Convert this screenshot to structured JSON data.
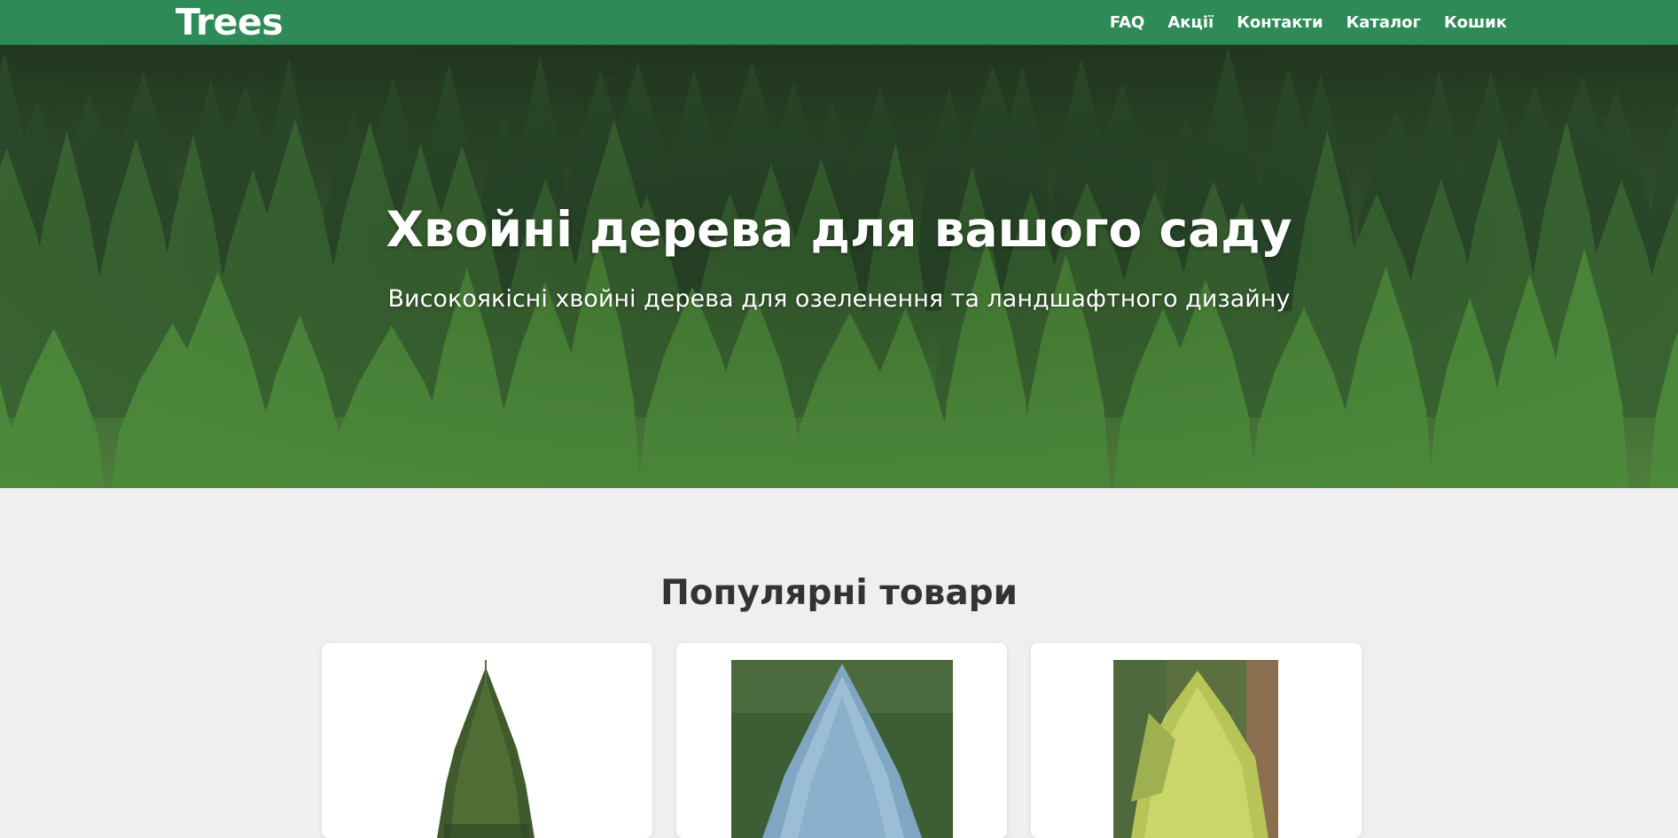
{
  "nav": {
    "logo": "Trees",
    "links": [
      "FAQ",
      "Акції",
      "Контакти",
      "Каталог",
      "Кошик"
    ]
  },
  "hero": {
    "title": "Хвойні дерева для вашого саду",
    "subtitle": "Високоякісні хвойні дерева для озеленення та ландшафтного дизайну",
    "background_image": "conifer-forest-photo"
  },
  "popular": {
    "title": "Популярні товари",
    "products": [
      {
        "image": "green-spruce-tree-photo"
      },
      {
        "image": "blue-spruce-tree-photo"
      },
      {
        "image": "golden-cypress-shrub-photo"
      }
    ]
  },
  "colors": {
    "brand_green": "#2e8b57",
    "page_background": "#efefef",
    "heading_text": "#333333"
  }
}
